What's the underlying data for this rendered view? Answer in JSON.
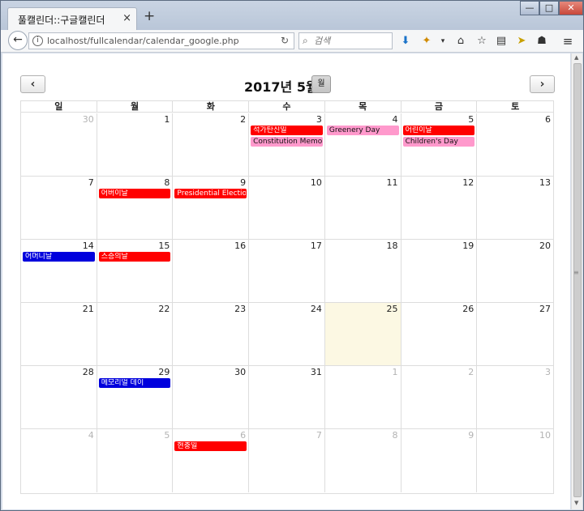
{
  "browser": {
    "tab_title": "풀캘린더::구글캘린더",
    "tab_close": "×",
    "new_tab": "+",
    "url": "localhost/fullcalendar/calendar_google.php",
    "search_placeholder": "검색",
    "window_buttons": {
      "minimize": "—",
      "maximize": "□",
      "close": "✕"
    }
  },
  "calendar": {
    "title": "2017년 5월",
    "view_button": "월",
    "prev": "‹",
    "next": "›",
    "weekdays": [
      "일",
      "월",
      "화",
      "수",
      "목",
      "금",
      "토"
    ],
    "weeks": [
      [
        {
          "d": "30",
          "o": true
        },
        {
          "d": "1"
        },
        {
          "d": "2"
        },
        {
          "d": "3"
        },
        {
          "d": "4"
        },
        {
          "d": "5"
        },
        {
          "d": "6"
        }
      ],
      [
        {
          "d": "7"
        },
        {
          "d": "8"
        },
        {
          "d": "9"
        },
        {
          "d": "10"
        },
        {
          "d": "11"
        },
        {
          "d": "12"
        },
        {
          "d": "13"
        }
      ],
      [
        {
          "d": "14"
        },
        {
          "d": "15"
        },
        {
          "d": "16"
        },
        {
          "d": "17"
        },
        {
          "d": "18"
        },
        {
          "d": "19"
        },
        {
          "d": "20"
        }
      ],
      [
        {
          "d": "21"
        },
        {
          "d": "22"
        },
        {
          "d": "23"
        },
        {
          "d": "24"
        },
        {
          "d": "25",
          "today": true
        },
        {
          "d": "26"
        },
        {
          "d": "27"
        }
      ],
      [
        {
          "d": "28"
        },
        {
          "d": "29"
        },
        {
          "d": "30"
        },
        {
          "d": "31"
        },
        {
          "d": "1",
          "o": true
        },
        {
          "d": "2",
          "o": true
        },
        {
          "d": "3",
          "o": true
        }
      ],
      [
        {
          "d": "4",
          "o": true
        },
        {
          "d": "5",
          "o": true
        },
        {
          "d": "6",
          "o": true
        },
        {
          "d": "7",
          "o": true
        },
        {
          "d": "8",
          "o": true
        },
        {
          "d": "9",
          "o": true
        },
        {
          "d": "10",
          "o": true
        }
      ]
    ],
    "events": [
      {
        "week": 0,
        "day": 3,
        "slot": 0,
        "title": "석가탄신일",
        "color": "#ff0000",
        "text": "#ffffff"
      },
      {
        "week": 0,
        "day": 3,
        "slot": 1,
        "title": "Constitution Memorial",
        "color": "#ff99cc",
        "text": "#111111"
      },
      {
        "week": 0,
        "day": 4,
        "slot": 0,
        "title": "Greenery Day",
        "color": "#ff99cc",
        "text": "#111111"
      },
      {
        "week": 0,
        "day": 5,
        "slot": 0,
        "title": "어린이날",
        "color": "#ff0000",
        "text": "#ffffff"
      },
      {
        "week": 0,
        "day": 5,
        "slot": 1,
        "title": "Children's Day",
        "color": "#ff99cc",
        "text": "#111111"
      },
      {
        "week": 1,
        "day": 1,
        "slot": 0,
        "title": "어버이날",
        "color": "#ff0000",
        "text": "#ffffff"
      },
      {
        "week": 1,
        "day": 2,
        "slot": 0,
        "title": "Presidential Election",
        "color": "#ff0000",
        "text": "#ffffff"
      },
      {
        "week": 2,
        "day": 0,
        "slot": 0,
        "title": "어머니날",
        "color": "#0000dd",
        "text": "#ffffff"
      },
      {
        "week": 2,
        "day": 1,
        "slot": 0,
        "title": "스승의날",
        "color": "#ff0000",
        "text": "#ffffff"
      },
      {
        "week": 4,
        "day": 1,
        "slot": 0,
        "title": "메모리얼 데이",
        "color": "#0000dd",
        "text": "#ffffff"
      },
      {
        "week": 5,
        "day": 2,
        "slot": 0,
        "title": "현충일",
        "color": "#ff0000",
        "text": "#ffffff"
      }
    ]
  }
}
